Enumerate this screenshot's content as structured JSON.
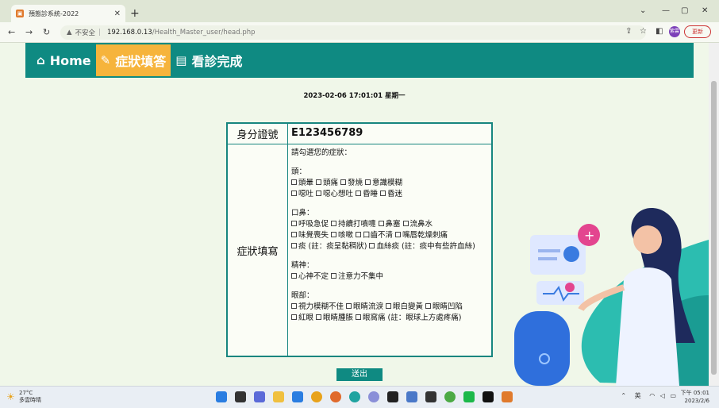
{
  "browser": {
    "tab_title": "預態診系統-2022",
    "url_security": "不安全",
    "url_host": "192.168.0.13",
    "url_path": "/Health_Master_user/head.php",
    "update_label": "更新",
    "profile_initial": "紫雲"
  },
  "navbar": {
    "items": [
      {
        "label": "Home",
        "icon": "home-icon"
      },
      {
        "label": "症狀填答",
        "icon": "edit-icon"
      },
      {
        "label": "看診完成",
        "icon": "id-card-icon"
      }
    ],
    "active_index": 1,
    "bg_color": "#0f8a82",
    "active_color": "#f6b43c"
  },
  "datetime": "2023-02-06 17:01:01 星期一",
  "form": {
    "id_label": "身分證號",
    "id_value": "E123456789",
    "symptom_label": "症狀填寫",
    "prompt": "請勾選您的症狀：",
    "sections": [
      {
        "title": "頭：",
        "lines": [
          [
            "頭暈",
            "頭痛",
            "發燒",
            "意識模糊"
          ],
          [
            "噁吐",
            "噁心想吐",
            "昏睡",
            "昏迷"
          ]
        ]
      },
      {
        "title": "口鼻：",
        "lines": [
          [
            "呼吸急促",
            "持續打噴嚏",
            "鼻塞",
            "流鼻水"
          ],
          [
            "味覺喪失",
            "咳嗽",
            "口齒不清",
            "嘴唇乾燥刺痛"
          ],
          [
            "痰 (註：痰呈黏稠狀)",
            "血絲痰 (註：痰中有些許血絲)"
          ]
        ]
      },
      {
        "title": "精神：",
        "lines": [
          [
            "心神不定",
            "注意力不集中"
          ]
        ]
      },
      {
        "title": "眼部：",
        "lines": [
          [
            "視力模糊不佳",
            "眼睛流淚",
            "眼白變黃",
            "眼睛凹陷"
          ],
          [
            "紅眼",
            "眼睛腫脹",
            "眼窩痛 (註：眼球上方處疼痛)"
          ]
        ]
      }
    ],
    "submit_label": "送出"
  },
  "taskbar": {
    "weather_temp": "27°C",
    "weather_desc": "多雲時晴",
    "lang": "英",
    "time": "下午 05:01",
    "date": "2023/2/6"
  }
}
